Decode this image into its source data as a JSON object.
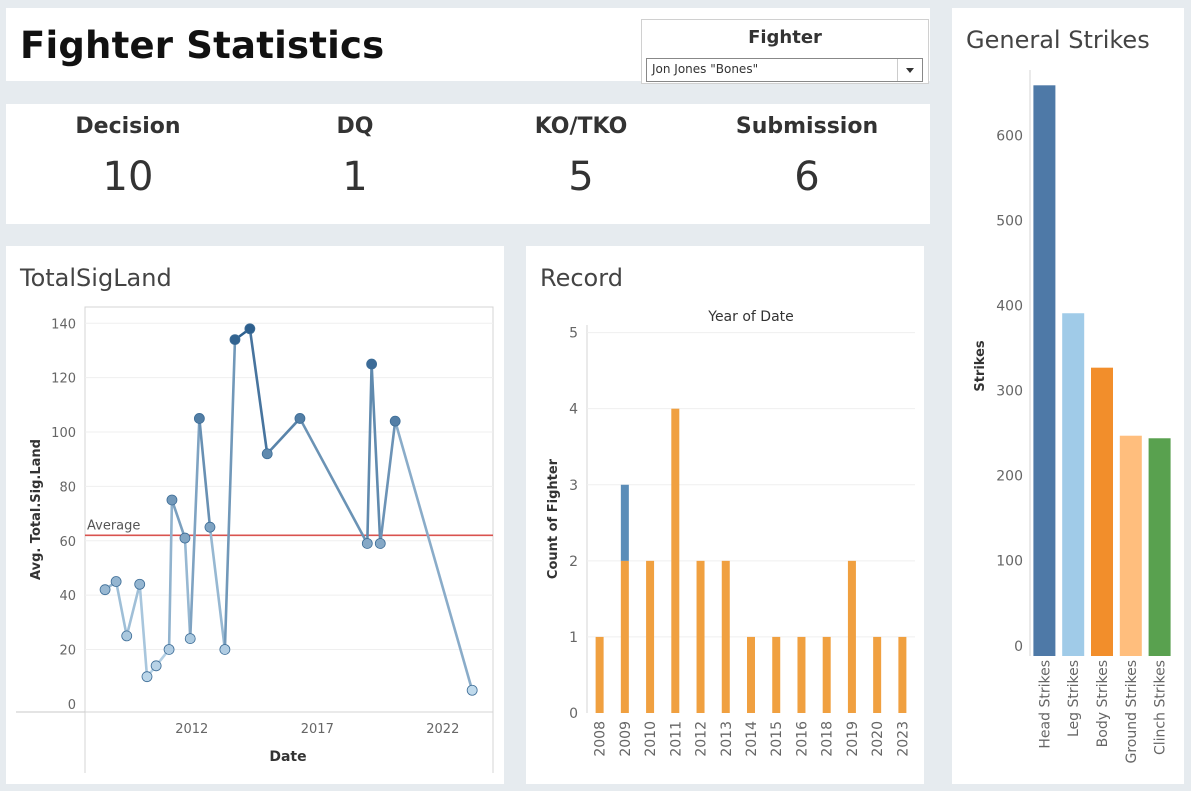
{
  "page_title": "Fighter Statistics",
  "filter": {
    "label": "Fighter",
    "value": "Jon Jones \"Bones\""
  },
  "kpis": [
    {
      "label": "Decision",
      "value": "10"
    },
    {
      "label": "DQ",
      "value": "1"
    },
    {
      "label": "KO/TKO",
      "value": "5"
    },
    {
      "label": "Submission",
      "value": "6"
    }
  ],
  "charts": {
    "sig": {
      "title": "TotalSigLand"
    },
    "record": {
      "title": "Record"
    },
    "strikes": {
      "title": "General Strikes"
    }
  },
  "chart_data": [
    {
      "type": "line",
      "title": "TotalSigLand",
      "xlabel": "Date",
      "ylabel": "Avg. Total.Sig.Land",
      "x_ticks": [
        "2012",
        "2017",
        "2022"
      ],
      "y_ticks": [
        0,
        20,
        40,
        60,
        80,
        100,
        120,
        140
      ],
      "ylim": [
        -3,
        146
      ],
      "reference_line": {
        "label": "Average",
        "value": 62,
        "color": "#d9534f"
      },
      "series": [
        {
          "values": [
            {
              "x": "2008-07-19",
              "y": 42
            },
            {
              "x": "2008-12-27",
              "y": 45
            },
            {
              "x": "2009-05-30",
              "y": 25
            },
            {
              "x": "2009-12-05",
              "y": 44
            },
            {
              "x": "2010-03-21",
              "y": 10
            },
            {
              "x": "2010-08-01",
              "y": 14
            },
            {
              "x": "2011-02-05",
              "y": 20
            },
            {
              "x": "2011-03-19",
              "y": 75
            },
            {
              "x": "2011-09-24",
              "y": 61
            },
            {
              "x": "2011-12-10",
              "y": 24
            },
            {
              "x": "2012-04-21",
              "y": 105
            },
            {
              "x": "2012-09-22",
              "y": 65
            },
            {
              "x": "2013-04-27",
              "y": 20
            },
            {
              "x": "2013-09-21",
              "y": 134
            },
            {
              "x": "2014-04-26",
              "y": 138
            },
            {
              "x": "2015-01-03",
              "y": 92
            },
            {
              "x": "2016-04-23",
              "y": 105
            },
            {
              "x": "2018-12-29",
              "y": 59
            },
            {
              "x": "2019-03-02",
              "y": 125
            },
            {
              "x": "2019-07-06",
              "y": 59
            },
            {
              "x": "2020-02-08",
              "y": 104
            },
            {
              "x": "2023-03-04",
              "y": 5
            }
          ]
        }
      ],
      "grid": true,
      "color_scale": [
        "#c6dff0",
        "#2b5d8c"
      ]
    },
    {
      "type": "bar",
      "title": "Record",
      "xlabel": "Year of Date",
      "ylabel": "Count of Fighter",
      "categories": [
        "2008",
        "2009",
        "2010",
        "2011",
        "2012",
        "2013",
        "2014",
        "2015",
        "2016",
        "2018",
        "2019",
        "2020",
        "2023"
      ],
      "series": [
        {
          "color": "#f0a040",
          "values": [
            1,
            2,
            2,
            4,
            2,
            2,
            1,
            1,
            1,
            1,
            2,
            1,
            1
          ]
        },
        {
          "color": "#5b8db8",
          "values": [
            0,
            1,
            0,
            0,
            0,
            0,
            0,
            0,
            0,
            0,
            0,
            0,
            0
          ]
        }
      ],
      "y_ticks": [
        0,
        1,
        2,
        3,
        4,
        5
      ],
      "ylim": [
        0,
        5.1
      ],
      "grid": true
    },
    {
      "type": "bar",
      "title": "General Strikes",
      "xlabel": "",
      "ylabel": "Strikes",
      "categories": [
        "Head Strikes",
        "Leg Strikes",
        "Body Strikes",
        "Ground Strikes",
        "Clinch Strikes"
      ],
      "values": [
        659,
        391,
        327,
        247,
        244
      ],
      "colors": [
        "#4e79a7",
        "#a0cbe8",
        "#f28e2b",
        "#ffbe7d",
        "#59a14f"
      ],
      "y_ticks": [
        0,
        100,
        200,
        300,
        400,
        500,
        600
      ],
      "ylim": [
        -12,
        677
      ],
      "grid": false
    }
  ]
}
